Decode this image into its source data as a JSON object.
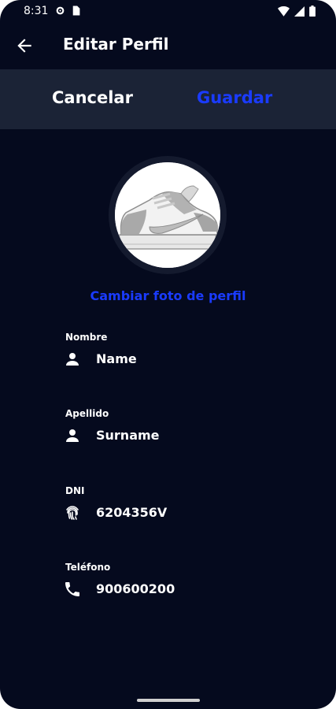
{
  "status_bar": {
    "time": "8:31"
  },
  "app_bar": {
    "title": "Editar Perfil"
  },
  "actions": {
    "cancel_label": "Cancelar",
    "save_label": "Guardar"
  },
  "profile": {
    "change_photo_label": "Cambiar foto de perfil"
  },
  "fields": [
    {
      "label": "Nombre",
      "value": "Name",
      "icon": "person-icon"
    },
    {
      "label": "Apellido",
      "value": "Surname",
      "icon": "person-icon"
    },
    {
      "label": "DNI",
      "value": "6204356V",
      "icon": "fingerprint-icon"
    },
    {
      "label": "Teléfono",
      "value": "900600200",
      "icon": "phone-icon"
    }
  ],
  "colors": {
    "background": "#050a1e",
    "action_bar": "#1b2336",
    "accent": "#1a3bff",
    "text": "#ffffff"
  }
}
